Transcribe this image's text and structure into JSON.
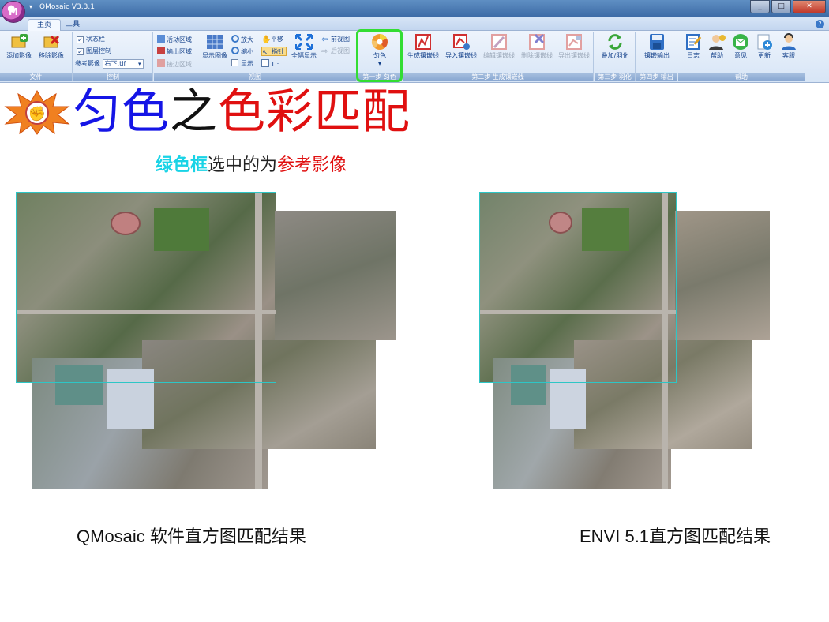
{
  "window": {
    "title": "QMosaic V3.3.1",
    "logo_text": "M",
    "qat_glyph": "▾",
    "controls": {
      "minimize": "_",
      "maximize": "□",
      "close": "✕"
    }
  },
  "tabs": [
    {
      "label": "主页"
    },
    {
      "label": "工具"
    }
  ],
  "help_round": "?",
  "ribbon": {
    "file": {
      "label": "文件",
      "add": "添加影像",
      "remove": "移除影像"
    },
    "control": {
      "label": "控制",
      "status_bar": "状态栏",
      "layer_control": "图层控制",
      "ref_label": "参考影像",
      "ref_value": "右下.tif",
      "combo_arrow": "▾"
    },
    "view": {
      "label": "视图",
      "active_area": "活动区域",
      "output_area": "输出区域",
      "seam_area": "接边区域",
      "show_image": "显示图像",
      "zoom_in": "放大",
      "zoom_out": "缩小",
      "show": "显示",
      "pan": "平移",
      "pointer": "指针",
      "ratio": "1 : 1",
      "full_view": "全幅显示",
      "prev_view": "前视图",
      "next_view": "后视图"
    },
    "step1": {
      "label": "第一步 匀色",
      "color_balance": "匀色",
      "dropdown": "▾"
    },
    "step2": {
      "label": "第二步 生成镶嵌线",
      "generate": "生成镶嵌线",
      "import": "导入镶嵌线",
      "edit": "编辑镶嵌线",
      "delete": "删除镶嵌线",
      "export": "导出镶嵌线"
    },
    "step3": {
      "label": "第三步 羽化",
      "feather": "叠加/羽化"
    },
    "step4": {
      "label": "第四步 输出",
      "output": "镶嵌输出"
    },
    "help": {
      "label": "帮助",
      "log": "日志",
      "help": "帮助",
      "feedback": "意见",
      "update": "更新",
      "service": "客服"
    }
  },
  "slide": {
    "burst_icon_glyph": "✊",
    "title": {
      "part1": "匀色",
      "part2": "之",
      "part3": "色彩匹配"
    },
    "subtitle": {
      "part1": "绿色框",
      "part2": "选中的为",
      "part3": "参考影像"
    },
    "caption_left": "QMosaic 软件直方图匹配结果",
    "caption_right": "ENVI 5.1直方图匹配结果"
  },
  "colors": {
    "title_blue": "#1515e6",
    "title_black": "#111111",
    "title_red": "#e01010",
    "subtitle_cyan": "#19d3e6",
    "subtitle_black": "#222222",
    "subtitle_red": "#e01010",
    "highlight_green": "#33dd33",
    "reference_box_cyan": "#2dc6c6"
  }
}
